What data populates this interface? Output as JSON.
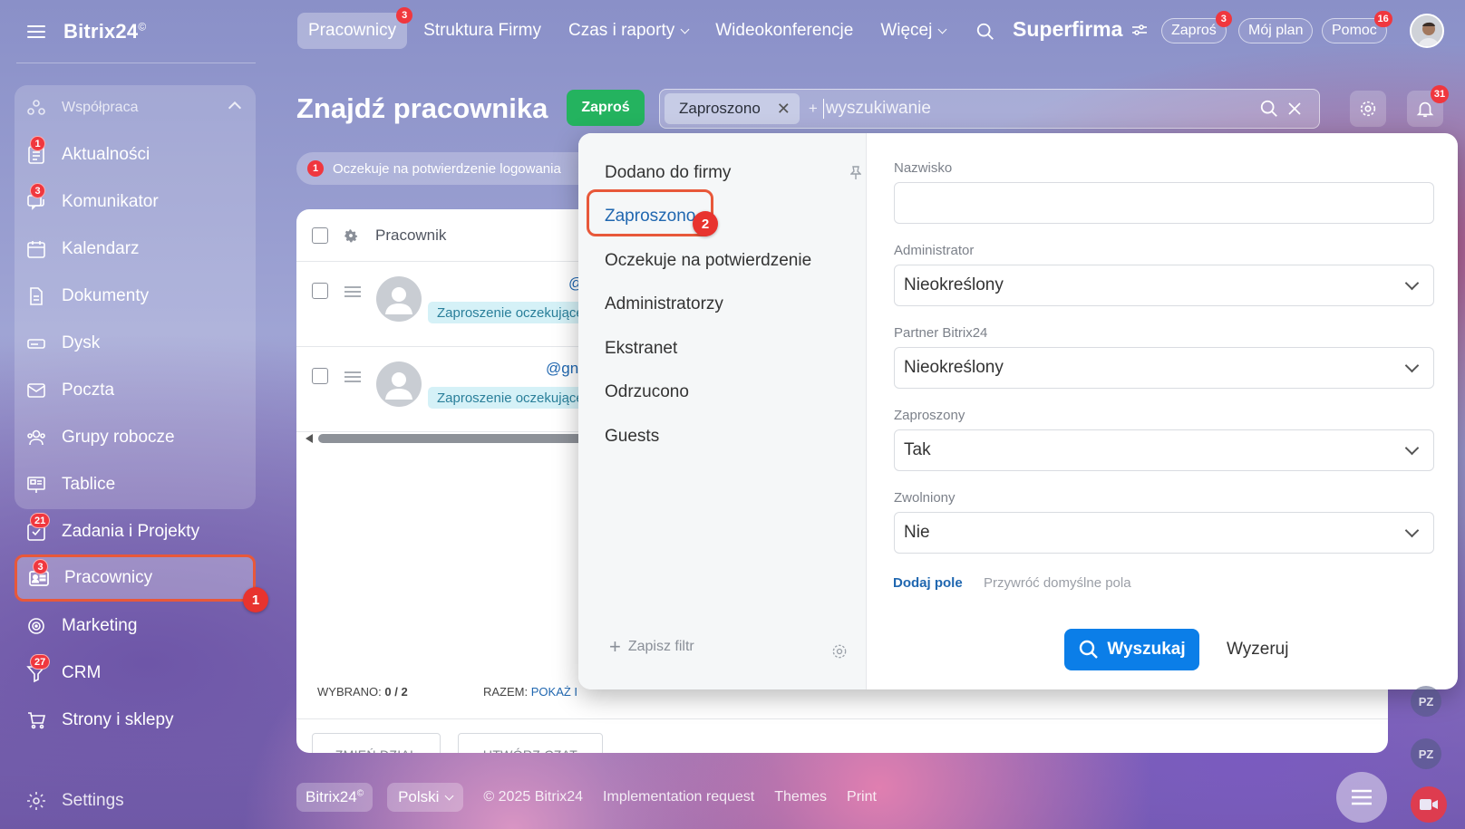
{
  "app": {
    "logo": "Bitrix24",
    "logo_mark": "©",
    "brand": "Superfirma"
  },
  "topnav": [
    {
      "label": "Pracownicy",
      "badge": "3",
      "active": true
    },
    {
      "label": "Struktura Firmy"
    },
    {
      "label": "Czas i raporty",
      "dropdown": true
    },
    {
      "label": "Wideokonferencje"
    },
    {
      "label": "Więcej",
      "dropdown": true
    }
  ],
  "top_pills": {
    "invite": {
      "label": "Zaproś",
      "badge": "3"
    },
    "plan": {
      "label": "Mój plan"
    },
    "help": {
      "label": "Pomoc",
      "badge": "16"
    }
  },
  "sidebar": {
    "section": "Współpraca",
    "items": [
      {
        "label": "Aktualności",
        "badge": "1",
        "icon": "news-icon"
      },
      {
        "label": "Komunikator",
        "badge": "3",
        "icon": "chat-icon"
      },
      {
        "label": "Kalendarz",
        "icon": "calendar-icon"
      },
      {
        "label": "Dokumenty",
        "icon": "document-icon"
      },
      {
        "label": "Dysk",
        "icon": "disk-icon"
      },
      {
        "label": "Poczta",
        "icon": "mail-icon"
      },
      {
        "label": "Grupy robocze",
        "icon": "groups-icon"
      },
      {
        "label": "Tablice",
        "icon": "board-icon"
      },
      {
        "label": "Zadania i Projekty",
        "badge": "21",
        "icon": "tasks-icon"
      },
      {
        "label": "Pracownicy",
        "badge": "3",
        "icon": "employees-icon",
        "active": true
      },
      {
        "label": "Marketing",
        "icon": "marketing-icon"
      },
      {
        "label": "CRM",
        "badge": "27",
        "icon": "crm-icon"
      },
      {
        "label": "Strony i sklepy",
        "icon": "cart-icon"
      }
    ],
    "settings": "Settings"
  },
  "steps": {
    "one": "1",
    "two": "2"
  },
  "page": {
    "title": "Znajdź pracownika",
    "invite_button": "Zaproś",
    "search": {
      "chip": "Zaproszono",
      "plus": "+",
      "placeholder": "wyszukiwanie"
    },
    "notifications_badge": "31",
    "notice": {
      "count": "1",
      "text": "Oczekuje na potwierdzenie logowania"
    }
  },
  "table": {
    "header": "Pracownik",
    "rows": [
      {
        "email": "@",
        "status": "Zaproszenie oczekujące"
      },
      {
        "email": "@gn",
        "status": "Zaproszenie oczekujące"
      }
    ],
    "selected_label": "WYBRANO:",
    "selected_value": "0 / 2",
    "total_label": "RAZEM:",
    "total_link": "POKAŻ I",
    "buttons": [
      "ZMIEŃ DZIAŁ",
      "UTWÓRZ CZAT"
    ]
  },
  "filter": {
    "presets": [
      "Dodano do firmy",
      "Zaproszono",
      "Oczekuje na potwierdzenie",
      "Administratorzy",
      "Ekstranet",
      "Odrzucono",
      "Guests"
    ],
    "active_preset": "Zaproszono",
    "save_filter": "Zapisz filtr",
    "fields": [
      {
        "label": "Nazwisko",
        "value": ""
      },
      {
        "label": "Administrator",
        "value": "Nieokreślony"
      },
      {
        "label": "Partner Bitrix24",
        "value": "Nieokreślony"
      },
      {
        "label": "Zaproszony",
        "value": "Tak"
      },
      {
        "label": "Zwolniony",
        "value": "Nie"
      }
    ],
    "add_field": "Dodaj pole",
    "restore_fields": "Przywróć domyślne pola",
    "search_button": "Wyszukaj",
    "reset_button": "Wyzeruj"
  },
  "footer": {
    "logo": "Bitrix24",
    "language": "Polski",
    "copyright": "© 2025 Bitrix24",
    "links": [
      "Implementation request",
      "Themes",
      "Print"
    ]
  },
  "right_rail": [
    "PZ",
    "PZ"
  ],
  "colors": {
    "accent_blue": "#0b7ee8",
    "success_green": "#24b35f",
    "badge_red": "#f0373e",
    "highlight_orange": "#e8583a"
  }
}
